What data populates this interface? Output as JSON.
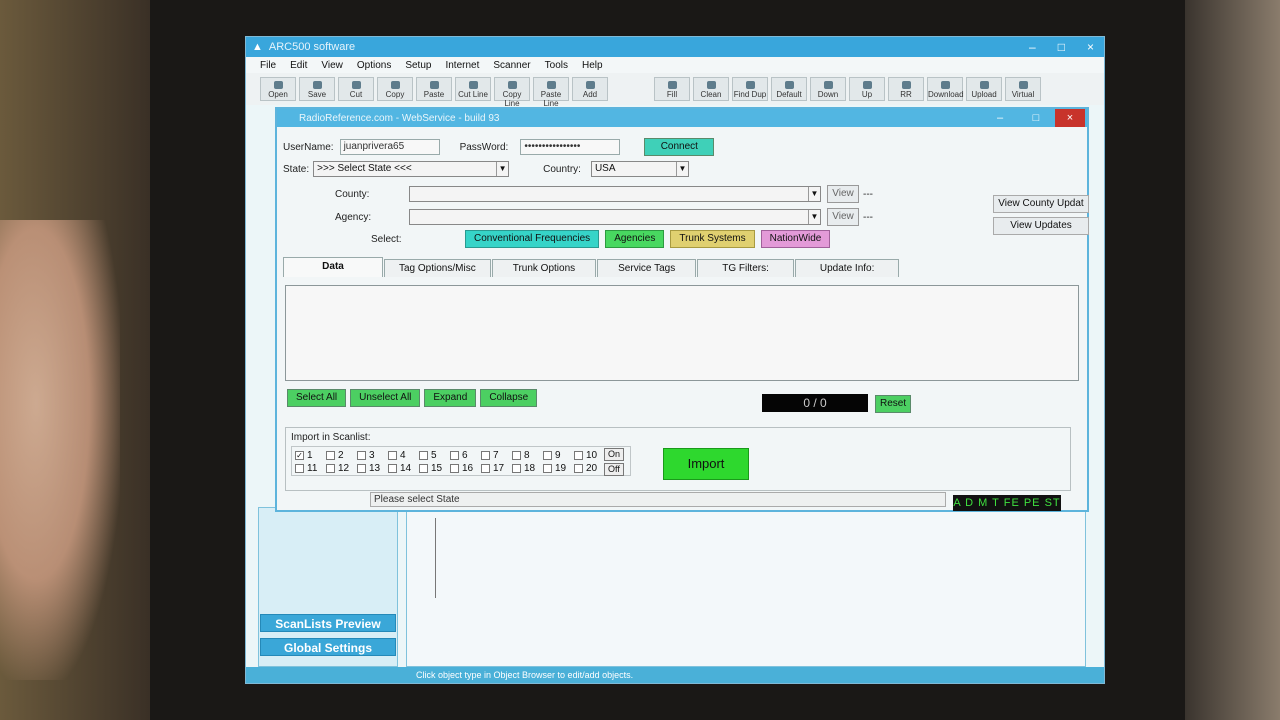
{
  "outer": {
    "title": "ARC500 software",
    "window_controls": [
      "–",
      "□",
      "×"
    ],
    "menu": [
      "File",
      "Edit",
      "View",
      "Options",
      "Setup",
      "Internet",
      "Scanner",
      "Tools",
      "Help"
    ],
    "toolbar": [
      "Open",
      "Save",
      "Cut",
      "Copy",
      "Paste",
      "Cut Line",
      "Copy Line",
      "Paste Line",
      "Add",
      "Fill",
      "Clean",
      "Find Dup",
      "Default",
      "Down",
      "Up",
      "RR",
      "Download",
      "Upload",
      "Virtual"
    ],
    "left_buttons": [
      "ScanLists Preview",
      "Global Settings"
    ],
    "status": "Click object type in Object Browser to edit/add objects."
  },
  "dialog": {
    "title": "RadioReference.com - WebService - build 93",
    "controls": [
      "–",
      "□",
      "×"
    ],
    "username_label": "UserName:",
    "username": "juanprivera65",
    "password_label": "PassWord:",
    "password": "••••••••••••••••",
    "connect": "Connect",
    "state_label": "State:",
    "state_value": ">>> Select State <<<",
    "country_label": "Country:",
    "country_value": "USA",
    "county_label": "County:",
    "agency_label": "Agency:",
    "view": "View",
    "dashes": "---",
    "view_county_updates": "View County Updat",
    "view_updates": "View Updates",
    "select_label": "Select:",
    "select_buttons": {
      "conventional": "Conventional Frequencies",
      "agencies": "Agencies",
      "trunk": "Trunk Systems",
      "nationwide": "NationWide"
    },
    "tabs": [
      "Data",
      "Tag Options/Misc",
      "Trunk Options",
      "Service Tags",
      "TG Filters:",
      "Update Info:"
    ],
    "actions": [
      "Select All",
      "Unselect All",
      "Expand",
      "Collapse"
    ],
    "counter": "0 / 0",
    "reset": "Reset",
    "import_label": "Import in Scanlist:",
    "scanlists_row1": [
      "1",
      "2",
      "3",
      "4",
      "5",
      "6",
      "7",
      "8",
      "9",
      "10"
    ],
    "scanlists_row2": [
      "11",
      "12",
      "13",
      "14",
      "15",
      "16",
      "17",
      "18",
      "19",
      "20"
    ],
    "on": "On",
    "off": "Off",
    "import": "Import",
    "message": "Please select State",
    "flags": "A D M T FE PE ST"
  },
  "colors": {
    "title_blue": "#39a6dc",
    "connect": "#3fd0b8",
    "conventional": "#36d4c8",
    "agencies": "#48d860",
    "trunk": "#e0d070",
    "nationwide": "#e39ad8",
    "green_btn": "#4ccf62",
    "import": "#2ed82e"
  }
}
